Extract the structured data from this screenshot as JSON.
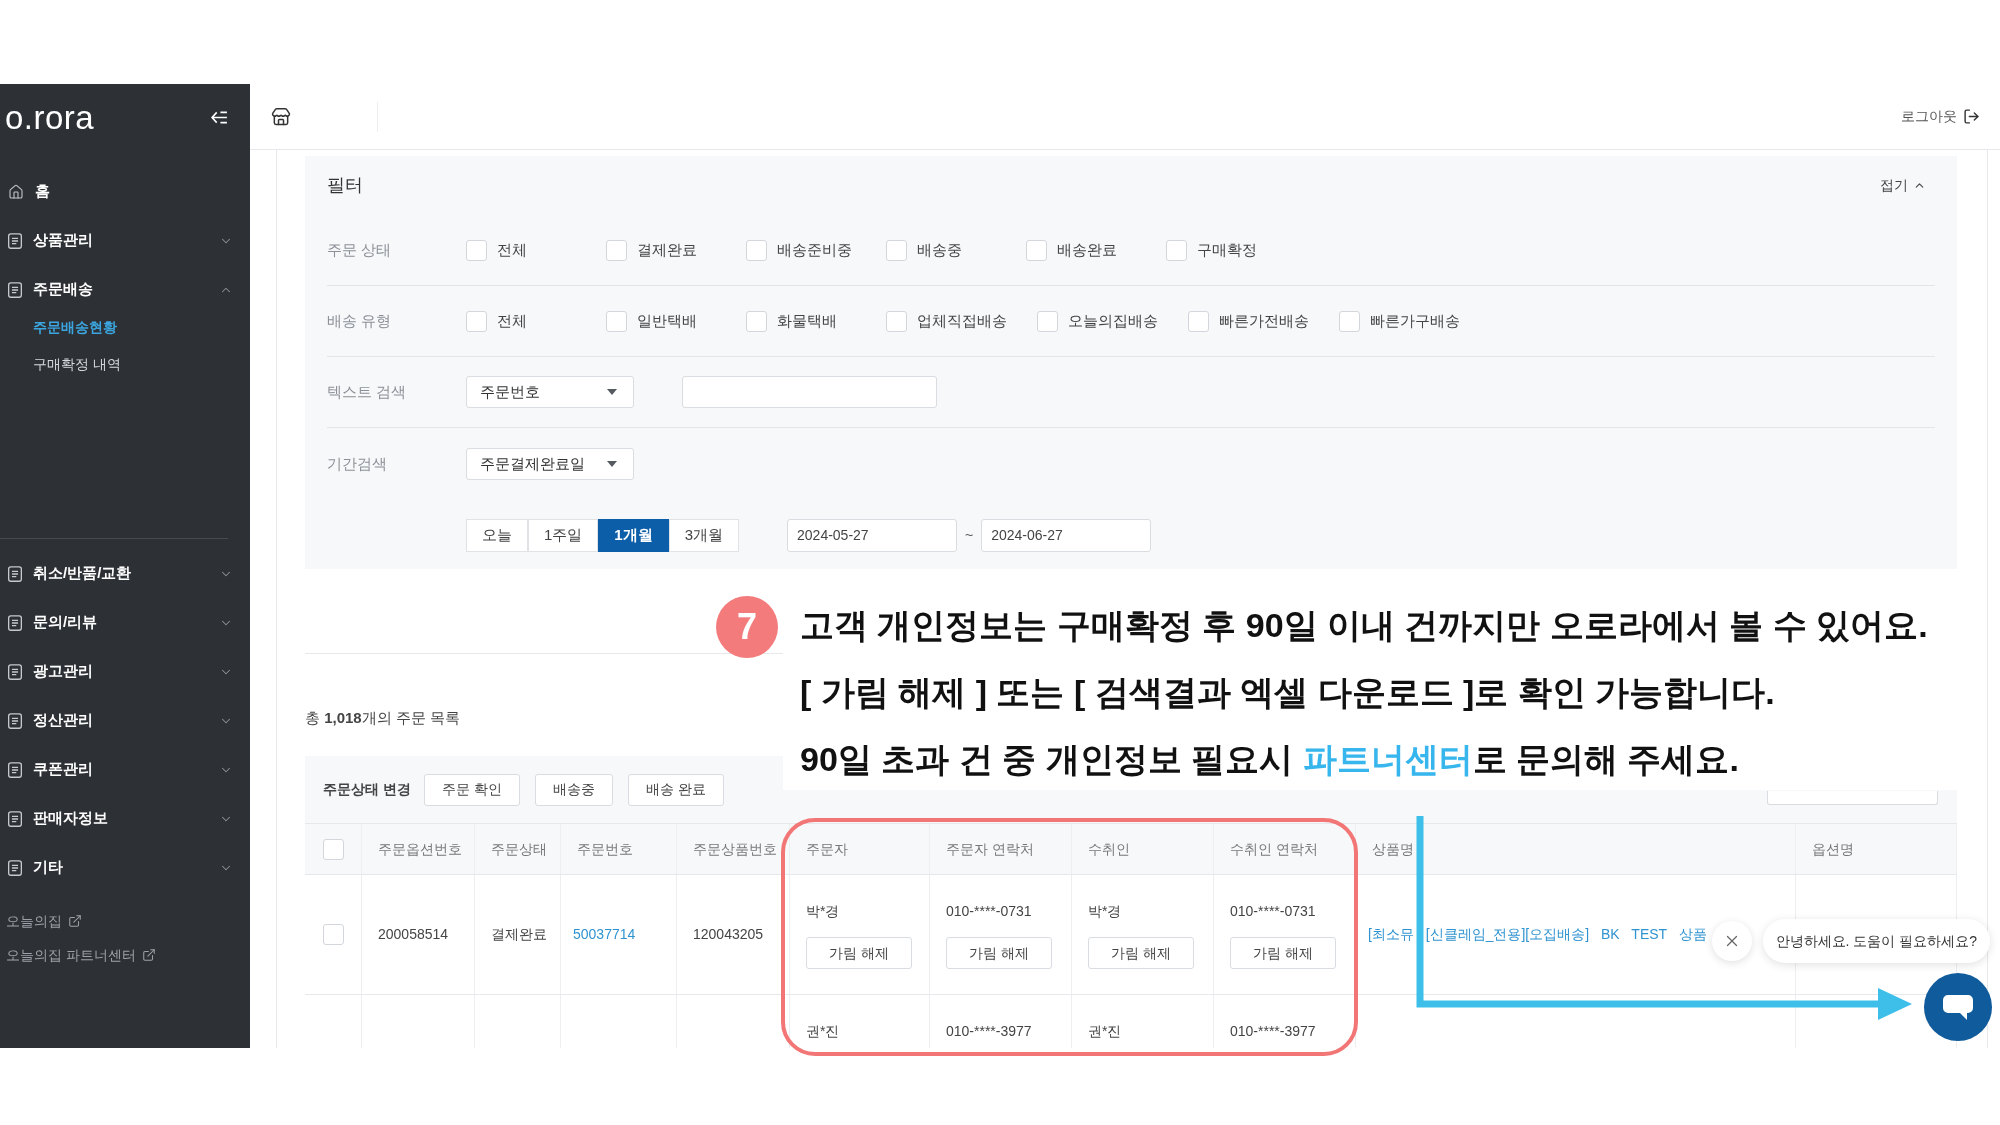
{
  "sidebar": {
    "logo": "o.rora",
    "sections": [
      {
        "items": [
          {
            "kind": "home",
            "label": "홈"
          },
          {
            "kind": "menu",
            "label": "상품관리",
            "expanded": false
          },
          {
            "kind": "menu",
            "label": "주문배송",
            "expanded": true,
            "children": [
              {
                "label": "주문배송현황",
                "selected": true
              },
              {
                "label": "구매확정 내역",
                "selected": false
              }
            ]
          }
        ]
      },
      {
        "items": [
          {
            "kind": "menu",
            "label": "취소/반품/교환",
            "expanded": false
          },
          {
            "kind": "menu",
            "label": "문의/리뷰",
            "expanded": false
          },
          {
            "kind": "menu",
            "label": "광고관리",
            "expanded": false
          },
          {
            "kind": "menu",
            "label": "정산관리",
            "expanded": false
          },
          {
            "kind": "menu",
            "label": "쿠폰관리",
            "expanded": false
          },
          {
            "kind": "menu",
            "label": "판매자정보",
            "expanded": false
          },
          {
            "kind": "menu",
            "label": "기타",
            "expanded": false
          }
        ]
      }
    ],
    "external_links": [
      {
        "label": "오늘의집"
      },
      {
        "label": "오늘의집 파트너센터"
      }
    ]
  },
  "header": {
    "logout": "로그아웃"
  },
  "filter": {
    "title": "필터",
    "collapse": "접기",
    "rows": [
      {
        "kind": "checkboxes",
        "label": "주문 상태",
        "options": [
          {
            "label": "전체",
            "checked": false
          },
          {
            "label": "결제완료",
            "checked": false
          },
          {
            "label": "배송준비중",
            "checked": false
          },
          {
            "label": "배송중",
            "checked": false
          },
          {
            "label": "배송완료",
            "checked": false
          },
          {
            "label": "구매확정",
            "checked": false
          }
        ]
      },
      {
        "kind": "checkboxes",
        "label": "배송 유형",
        "options": [
          {
            "label": "전체",
            "checked": false
          },
          {
            "label": "일반택배",
            "checked": false
          },
          {
            "label": "화물택배",
            "checked": false
          },
          {
            "label": "업체직접배송",
            "checked": false
          },
          {
            "label": "오늘의집배송",
            "checked": false
          },
          {
            "label": "빠른가전배송",
            "checked": false
          },
          {
            "label": "빠른가구배송",
            "checked": false
          }
        ]
      },
      {
        "kind": "text_search",
        "label": "텍스트 검색",
        "select": "주문번호"
      },
      {
        "kind": "period",
        "label": "기간검색",
        "select": "주문결제완료일",
        "presets": [
          {
            "label": "오늘",
            "selected": false
          },
          {
            "label": "1주일",
            "selected": false
          },
          {
            "label": "1개월",
            "selected": true
          },
          {
            "label": "3개월",
            "selected": false
          }
        ],
        "from": "2024-05-27",
        "separator": "~",
        "to": "2024-06-27"
      }
    ]
  },
  "orders": {
    "summary": "총 **1,018**개의 주문 목록",
    "toolbar": {
      "label": "주문상태 변경",
      "buttons": [
        "주문 확인",
        "배송중",
        "배송 완료"
      ]
    },
    "all_checked": false,
    "columns": [
      "주문옵션번호",
      "주문상태",
      "주문번호",
      "주문상품번호",
      "주문자",
      "주문자 연락처",
      "수취인",
      "수취인 연락처",
      "상품명",
      "옵션명"
    ],
    "rows": [
      {
        "checked": false,
        "cells": [
          {
            "kind": "plain",
            "text": "200058514"
          },
          {
            "kind": "plain",
            "text": "결제완료"
          },
          {
            "kind": "link",
            "text": "50037714"
          },
          {
            "kind": "plain",
            "text": "120043205"
          },
          {
            "kind": "masked",
            "text": "박*경",
            "button": "가림 해제"
          },
          {
            "kind": "masked",
            "text": "010-****-0731",
            "button": "가림 해제"
          },
          {
            "kind": "masked",
            "text": "박*경",
            "button": "가림 해제"
          },
          {
            "kind": "masked",
            "text": "010-****-0731",
            "button": "가림 해제"
          },
          {
            "kind": "link",
            "text": "[최소뮤 [신클레임_전용][오집배송] BK TEST 상품"
          },
          {
            "kind": "empty"
          }
        ]
      },
      {
        "cells": [
          {
            "kind": "empty"
          },
          {
            "kind": "empty"
          },
          {
            "kind": "empty"
          },
          {
            "kind": "empty"
          },
          {
            "kind": "masked",
            "text": "권*진"
          },
          {
            "kind": "masked",
            "text": "010-****-3977"
          },
          {
            "kind": "masked",
            "text": "권*진"
          },
          {
            "kind": "masked",
            "text": "010-****-3977"
          },
          {
            "kind": "empty"
          },
          {
            "kind": "empty"
          }
        ]
      }
    ]
  },
  "chat": {
    "greeting": "안녕하세요. 도움이 필요하세요?"
  },
  "annotation": {
    "number": "7",
    "lines": [
      [
        {
          "text": "고객 개인정보는 구매확정 후 90일 이내 건까지만 오로라에서 볼 수 있어요.",
          "highlight": false
        }
      ],
      [
        {
          "text": "[ 가림 해제 ] 또는 [ 검색결과 엑셀 다운로드 ]로 확인 가능합니다.",
          "highlight": false
        }
      ],
      [
        {
          "text": "90일 초과 건 중 개인정보 필요시 ",
          "highlight": false
        },
        {
          "text": "파트너센터",
          "highlight": true
        },
        {
          "text": "로 문의해 주세요.",
          "highlight": false
        }
      ]
    ]
  }
}
